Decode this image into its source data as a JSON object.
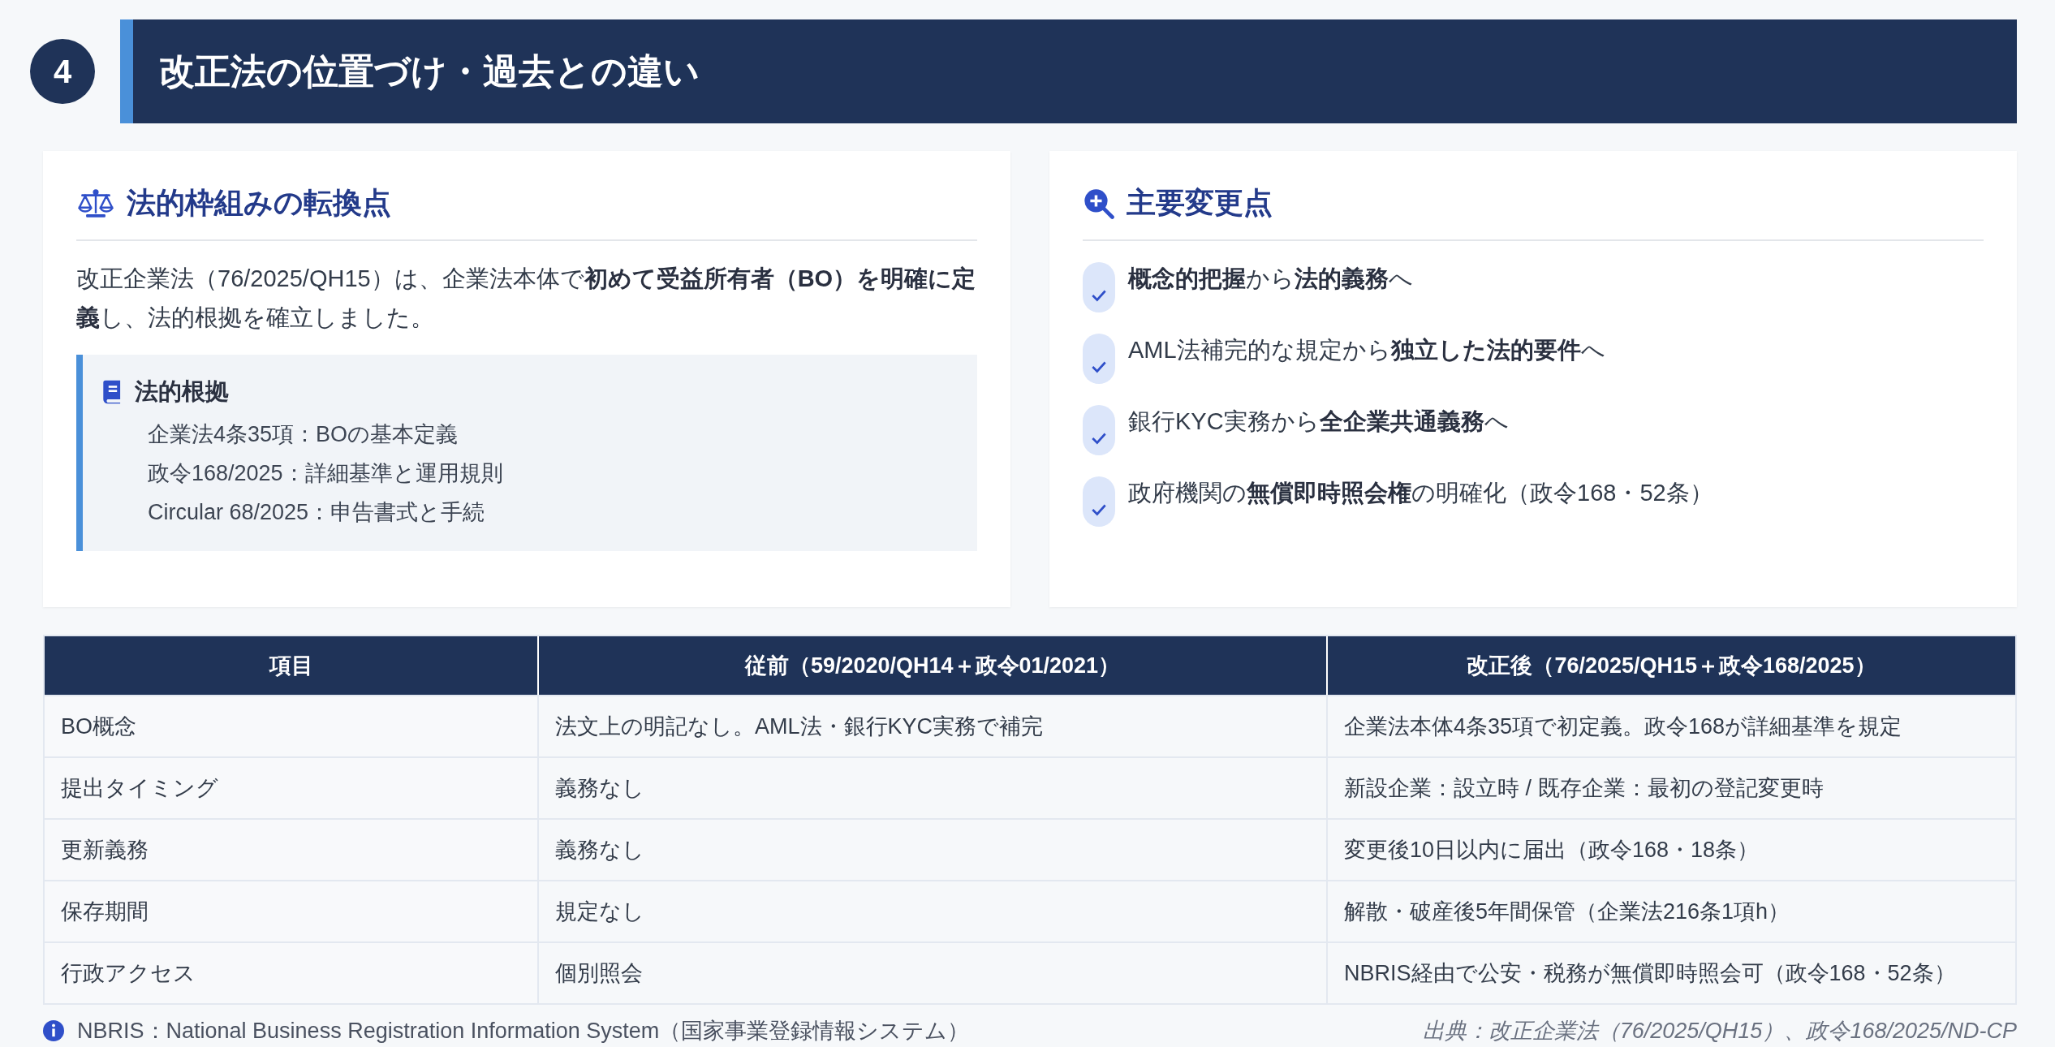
{
  "section": {
    "number": "4",
    "title": "改正法の位置づけ・過去との違い"
  },
  "left_card": {
    "title": "法的枠組みの転換点",
    "intro": "改正企業法（76/2025/QH15）は、企業法本体で**初めて受益所有者（BO）を明確に定義**し、法的根拠を確立しました。",
    "basis": {
      "title": "法的根拠",
      "items": [
        "企業法4条35項：BOの基本定義",
        "政令168/2025：詳細基準と運用規則",
        "Circular 68/2025：申告書式と手続"
      ]
    }
  },
  "right_card": {
    "title": "主要変更点",
    "items": [
      {
        "text": "**概念的把握**から**法的義務**へ",
        "checked": true
      },
      {
        "text": "AML法補完的な規定から**独立した法的要件**へ",
        "checked": true
      },
      {
        "text": "銀行KYC実務から**全企業共通義務**へ",
        "checked": true
      },
      {
        "text": "政府機関の**無償即時照会権**の明確化（政令168・52条）",
        "checked": true
      }
    ]
  },
  "table": {
    "columns": [
      "項目",
      "従前（59/2020/QH14＋政令01/2021）",
      "改正後（76/2025/QH15＋政令168/2025）"
    ],
    "rows": [
      [
        "BO概念",
        "法文上の明記なし。AML法・銀行KYC実務で補完",
        "企業法本体4条35項で初定義。政令168が詳細基準を規定"
      ],
      [
        "提出タイミング",
        "義務なし",
        "新設企業：設立時 / 既存企業：最初の登記変更時"
      ],
      [
        "更新義務",
        "義務なし",
        "変更後10日以内に届出（政令168・18条）"
      ],
      [
        "保存期間",
        "規定なし",
        "解散・破産後5年間保管（企業法216条1項h）"
      ],
      [
        "行政アクセス",
        "個別照会",
        "NBRIS経由で公安・税務が無償即時照会可（政令168・52条）"
      ]
    ]
  },
  "footer": {
    "note": "NBRIS：National Business Registration Information System（国家事業登録情報システム）",
    "source": "出典：改正企業法（76/2025/QH15）、政令168/2025/ND-CP"
  }
}
